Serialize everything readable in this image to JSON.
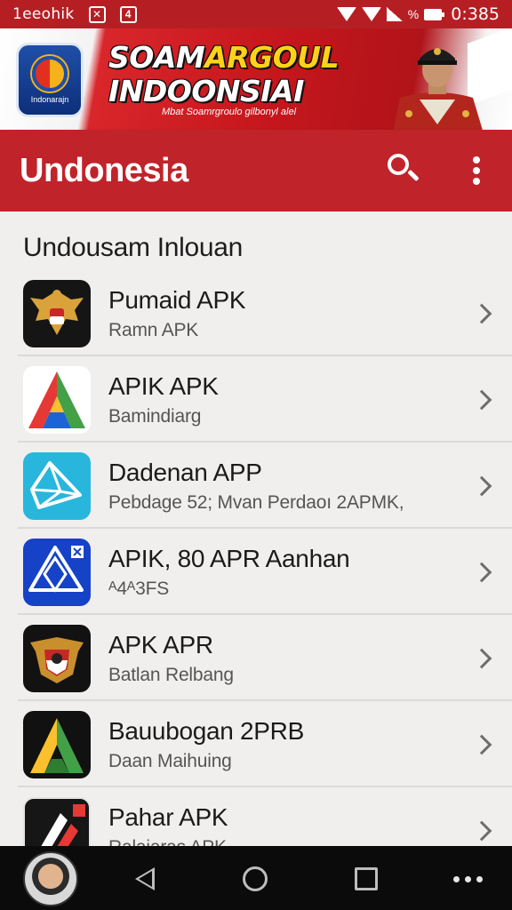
{
  "status_bar": {
    "carrier": "1eeohik",
    "icon_a": "✕",
    "icon_b": "4",
    "percent_symbol": "%",
    "time": "0:385"
  },
  "banner": {
    "headline_line1_a": "SOAM",
    "headline_line1_b": "ARGOUL",
    "headline_line2": "INDOONSIAI",
    "tagline": "Mbat Soamrgroulo gilbonyl alel",
    "logo_text": "Indonarajn"
  },
  "app_bar": {
    "title": "Undonesia"
  },
  "section": {
    "title": "Undousam Inlouan"
  },
  "apps": [
    {
      "title": "Pumaid APK",
      "subtitle": "Ramn APK"
    },
    {
      "title": "APIK APK",
      "subtitle": "Bamindiarg"
    },
    {
      "title": "Dadenan APP",
      "subtitle": "Pebdage 52; Mvan Perdaoı 2APMK,"
    },
    {
      "title": "APIK, 80 APR Aanhan",
      "subtitle": "ᴬ4ᴬ3FS"
    },
    {
      "title": "APK APR",
      "subtitle": "Batlan Relbang"
    },
    {
      "title": "Bauubogan 2PRB",
      "subtitle": "Daan Maihuing"
    },
    {
      "title": "Pahar APK",
      "subtitle": "Ralaiaras APK"
    }
  ],
  "colors": {
    "primary": "#c1232a",
    "status_bar": "#b51f24",
    "background": "#f1efee",
    "nav_bar": "#0b0b0b"
  }
}
